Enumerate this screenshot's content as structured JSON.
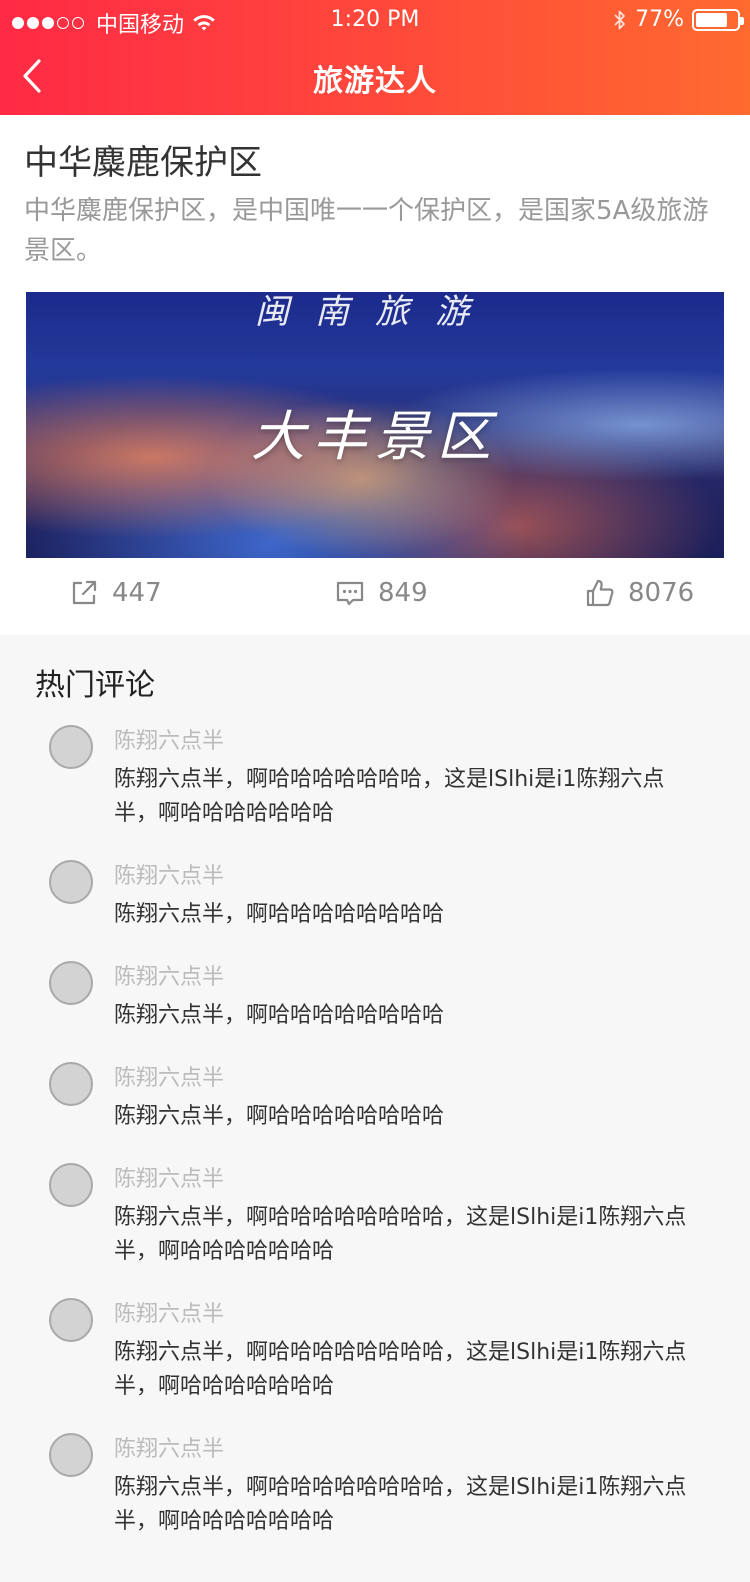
{
  "status_bar": {
    "carrier": "中国移动",
    "time": "1:20 PM",
    "battery": "77%",
    "battery_level": 0.77,
    "signal_bars": 3,
    "signal_total": 5
  },
  "nav": {
    "title": "旅游达人",
    "back_icon": "chevron-left-icon"
  },
  "article": {
    "title": "中华麋鹿保护区",
    "description": "中华麋鹿保护区，是中国唯一一个保护区，是国家5A级旅游景区。",
    "image_text_top": "闽南旅游",
    "image_text_main": "大丰景区"
  },
  "stats": {
    "shares": "447",
    "comments": "849",
    "likes": "8076"
  },
  "comments_section": {
    "title": "热门评论",
    "items": [
      {
        "name": "陈翔六点半",
        "text": "陈翔六点半，啊哈哈哈哈哈哈哈，这是lSlhi是i1陈翔六点半，啊哈哈哈哈哈哈哈"
      },
      {
        "name": "陈翔六点半",
        "text": "陈翔六点半，啊哈哈哈哈哈哈哈哈"
      },
      {
        "name": "陈翔六点半",
        "text": "陈翔六点半，啊哈哈哈哈哈哈哈哈"
      },
      {
        "name": "陈翔六点半",
        "text": "陈翔六点半，啊哈哈哈哈哈哈哈哈"
      },
      {
        "name": "陈翔六点半",
        "text": "陈翔六点半，啊哈哈哈哈哈哈哈哈，这是lSlhi是i1陈翔六点半，啊哈哈哈哈哈哈哈"
      },
      {
        "name": "陈翔六点半",
        "text": "陈翔六点半，啊哈哈哈哈哈哈哈哈，这是lSlhi是i1陈翔六点半，啊哈哈哈哈哈哈哈"
      },
      {
        "name": "陈翔六点半",
        "text": "陈翔六点半，啊哈哈哈哈哈哈哈哈，这是lSlhi是i1陈翔六点半，啊哈哈哈哈哈哈哈"
      }
    ]
  },
  "colors": {
    "header_start": "#ff2a45",
    "header_end": "#ff6a2f",
    "muted_text": "#999999",
    "avatar_fill": "#d3d3d3"
  }
}
